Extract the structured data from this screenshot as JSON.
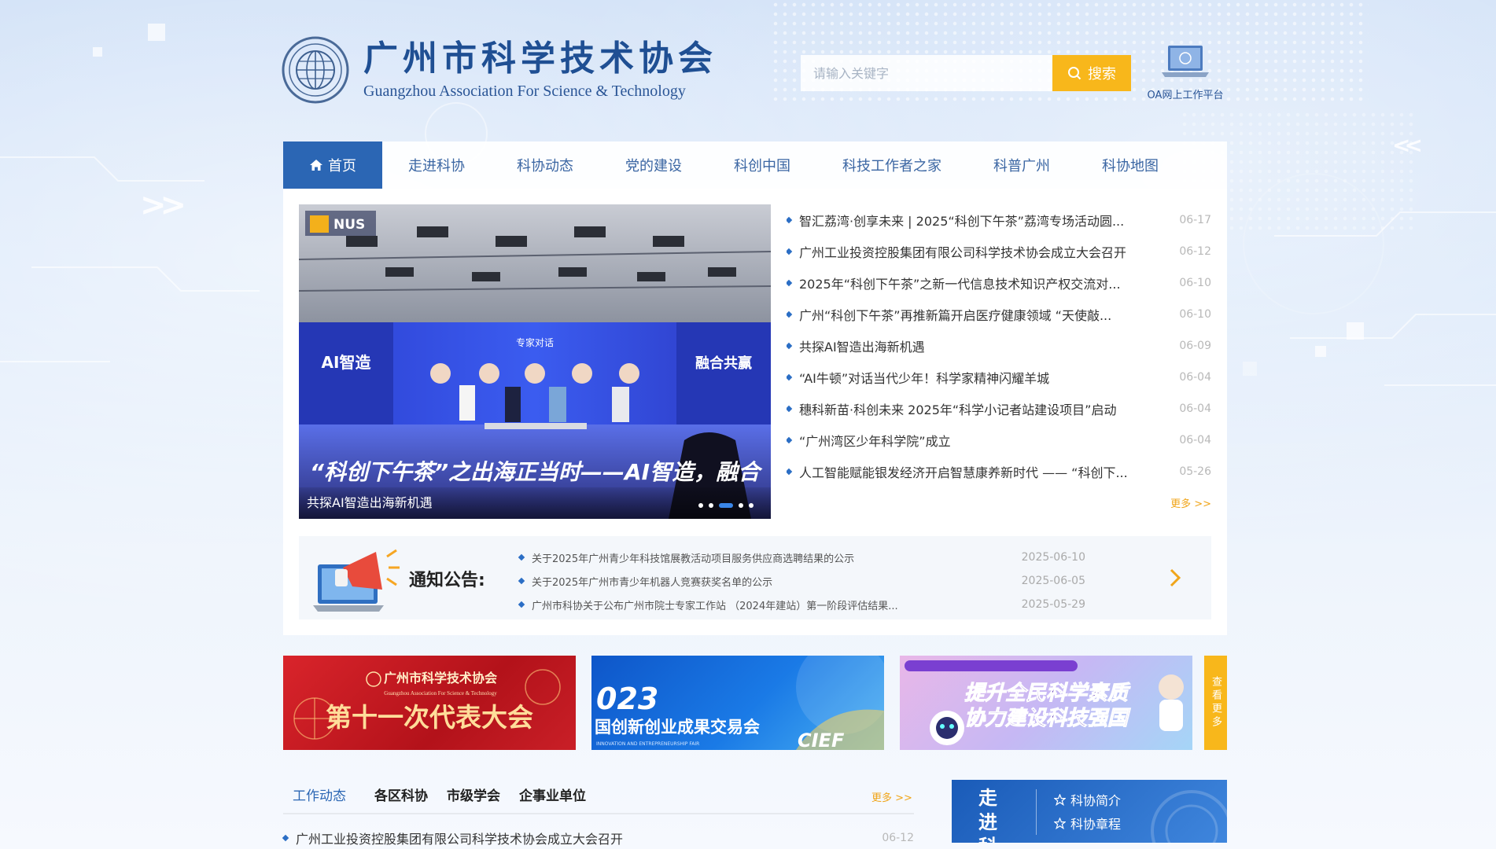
{
  "header": {
    "title_cn": "广州市科学技术协会",
    "title_en": "Guangzhou Association For Science & Technology",
    "search_placeholder": "请输入关键字",
    "search_button": "搜索",
    "oa_label": "OA网上工作平台"
  },
  "nav": {
    "items": [
      {
        "label": "首页"
      },
      {
        "label": "走进科协"
      },
      {
        "label": "科协动态"
      },
      {
        "label": "党的建设"
      },
      {
        "label": "科创中国"
      },
      {
        "label": "科技工作者之家"
      },
      {
        "label": "科普广州"
      },
      {
        "label": "科协地图"
      }
    ]
  },
  "slider": {
    "caption": "共探AI智造出海新机遇",
    "banner_text": "“科创下午茶”之出海正当时——AI智造，融合",
    "stage_left": "AI智造",
    "stage_right": "融合共赢",
    "stage_center": "专家对话",
    "logo_text": "NUS",
    "dot_count": 5,
    "active_dot": 2
  },
  "news": {
    "items": [
      {
        "title": "智汇荔湾·创享未来 | 2025“科创下午茶”荔湾专场活动圆...",
        "date": "06-17"
      },
      {
        "title": "广州工业投资控股集团有限公司科学技术协会成立大会召开",
        "date": "06-12"
      },
      {
        "title": "2025年“科创下午茶”之新一代信息技术知识产权交流对...",
        "date": "06-10"
      },
      {
        "title": "广州“科创下午茶”再推新篇开启医疗健康领域 “天使敲...",
        "date": "06-10"
      },
      {
        "title": "共探AI智造出海新机遇",
        "date": "06-09"
      },
      {
        "title": "“AI牛顿”对话当代少年！科学家精神闪耀羊城",
        "date": "06-04"
      },
      {
        "title": "穗科新苗·科创未来 2025年“科学小记者站建设项目”启动",
        "date": "06-04"
      },
      {
        "title": "“广州湾区少年科学院”成立",
        "date": "06-04"
      },
      {
        "title": "人工智能赋能银发经济开启智慧康养新时代 —— “科创下...",
        "date": "05-26"
      }
    ],
    "more": "更多 >>"
  },
  "notice": {
    "title": "通知公告:",
    "items": [
      {
        "title": "关于2025年广州青少年科技馆展教活动项目服务供应商选聘结果的公示",
        "date": "2025-06-10"
      },
      {
        "title": "关于2025年广州市青少年机器人竞赛获奖名单的公示",
        "date": "2025-06-05"
      },
      {
        "title": "广州市科协关于公布广州市院士专家工作站 （2024年建站）第一阶段评估结果...",
        "date": "2025-05-29"
      }
    ]
  },
  "banners": {
    "b1_org": "广州市科学技术协会",
    "b1_org_en": "Guangzhou Association For Science & Technology",
    "b1_main": "第十一次代表大会",
    "b2_year": "023",
    "b2_main": "国创新创业成果交易会",
    "b2_en": "INNOVATION AND ENTREPRENEURSHIP FAIR",
    "b2_brand": "CIEF",
    "b3_line1": "提升全民科学素质",
    "b3_line2": "协力建设科技强国",
    "more_vertical": "查看更多"
  },
  "work": {
    "tabs": [
      {
        "label": "工作动态"
      },
      {
        "label": "各区科协"
      },
      {
        "label": "市级学会"
      },
      {
        "label": "企事业单位"
      }
    ],
    "more": "更多 >>",
    "items": [
      {
        "title": "广州工业投资控股集团有限公司科学技术协会成立大会召开",
        "date": "06-12"
      }
    ]
  },
  "intro": {
    "title": "走进科协",
    "links": [
      {
        "label": "科协简介"
      },
      {
        "label": "科协章程"
      }
    ]
  },
  "colors": {
    "primary": "#2b66b4",
    "accent": "#f8b71b",
    "nav_text": "#3b66a3"
  }
}
